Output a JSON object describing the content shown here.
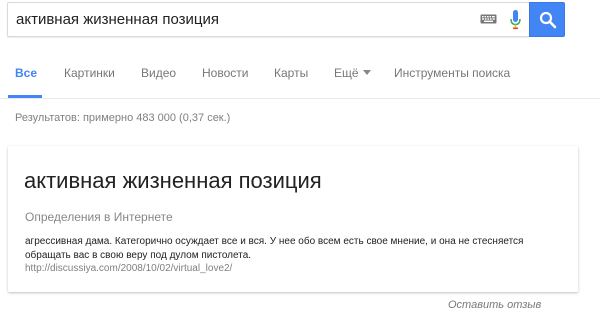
{
  "search": {
    "query": "активная жизненная позиция",
    "keyboard_icon": "keyboard-icon",
    "mic_icon": "microphone-icon",
    "button_icon": "search-icon",
    "accent_color": "#4285f4"
  },
  "tabs": [
    {
      "label": "Все",
      "active": true
    },
    {
      "label": "Картинки",
      "active": false
    },
    {
      "label": "Видео",
      "active": false
    },
    {
      "label": "Новости",
      "active": false
    },
    {
      "label": "Карты",
      "active": false
    },
    {
      "label": "Ещё",
      "active": false,
      "has_dropdown": true
    },
    {
      "label": "Инструменты поиска",
      "active": false
    }
  ],
  "result_stats": "Результатов: примерно 483 000 (0,37 сек.)",
  "card": {
    "title": "активная жизненная позиция",
    "subtitle": "Определения в Интернете",
    "text": "агрессивная дама. Категорично осуждает все и вся. У нее обо всем есть свое мнение, и она не стесняется обращать вас в свою веру под дулом пистолета.",
    "link": "http://discussiya.com/2008/10/02/virtual_love2/"
  },
  "feedback": "Оставить отзыв"
}
